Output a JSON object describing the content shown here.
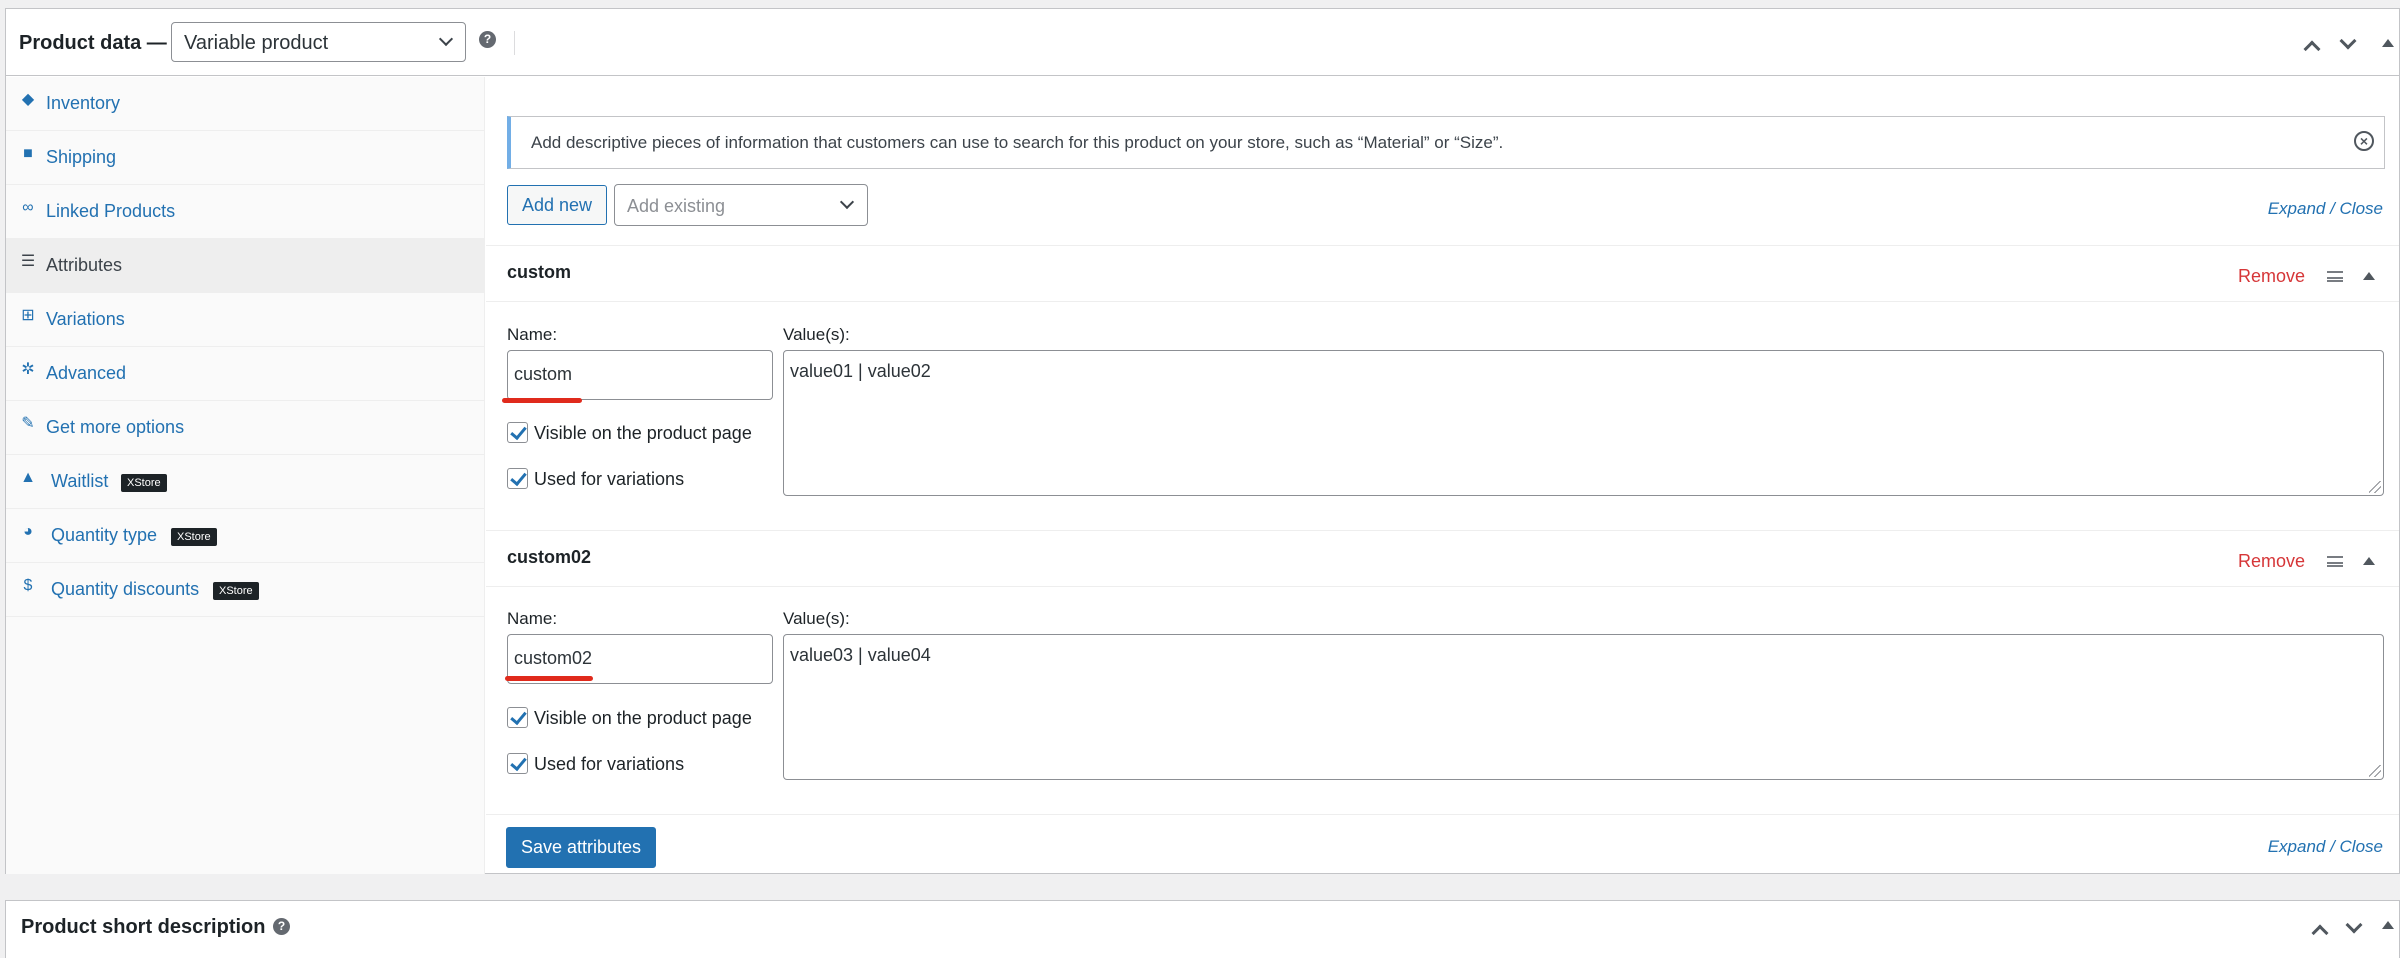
{
  "product_data": {
    "title": "Product data —",
    "type_select": "Variable product",
    "help": "?"
  },
  "sidebar": {
    "items": [
      {
        "label": "Inventory",
        "icon": "tag-icon"
      },
      {
        "label": "Shipping",
        "icon": "truck-icon"
      },
      {
        "label": "Linked Products",
        "icon": "link-icon"
      },
      {
        "label": "Attributes",
        "icon": "list-view-icon"
      },
      {
        "label": "Variations",
        "icon": "grid-icon"
      },
      {
        "label": "Advanced",
        "icon": "gear-icon"
      },
      {
        "label": "Get more options",
        "icon": "plugin-icon"
      },
      {
        "label": "Waitlist",
        "icon": "bell-icon",
        "badge": "XStore"
      },
      {
        "label": "Quantity type",
        "icon": "pie-chart-icon",
        "badge": "XStore"
      },
      {
        "label": "Quantity discounts",
        "icon": "dollar-icon",
        "badge": "XStore"
      }
    ]
  },
  "attributes": {
    "notice": "Add descriptive pieces of information that customers can use to search for this product on your store, such as “Material” or “Size”.",
    "add_new": "Add new",
    "add_existing_placeholder": "Add existing",
    "expand_close": "Expand / Close",
    "remove": "Remove",
    "name_label": "Name:",
    "values_label": "Value(s):",
    "visible_label": "Visible on the product page",
    "variations_label": "Used for variations",
    "items": [
      {
        "name": "custom",
        "values": "value01 | value02"
      },
      {
        "name": "custom02",
        "values": "value03 | value04"
      }
    ],
    "save": "Save attributes"
  },
  "short_description": {
    "title": "Product short description",
    "help": "?"
  }
}
